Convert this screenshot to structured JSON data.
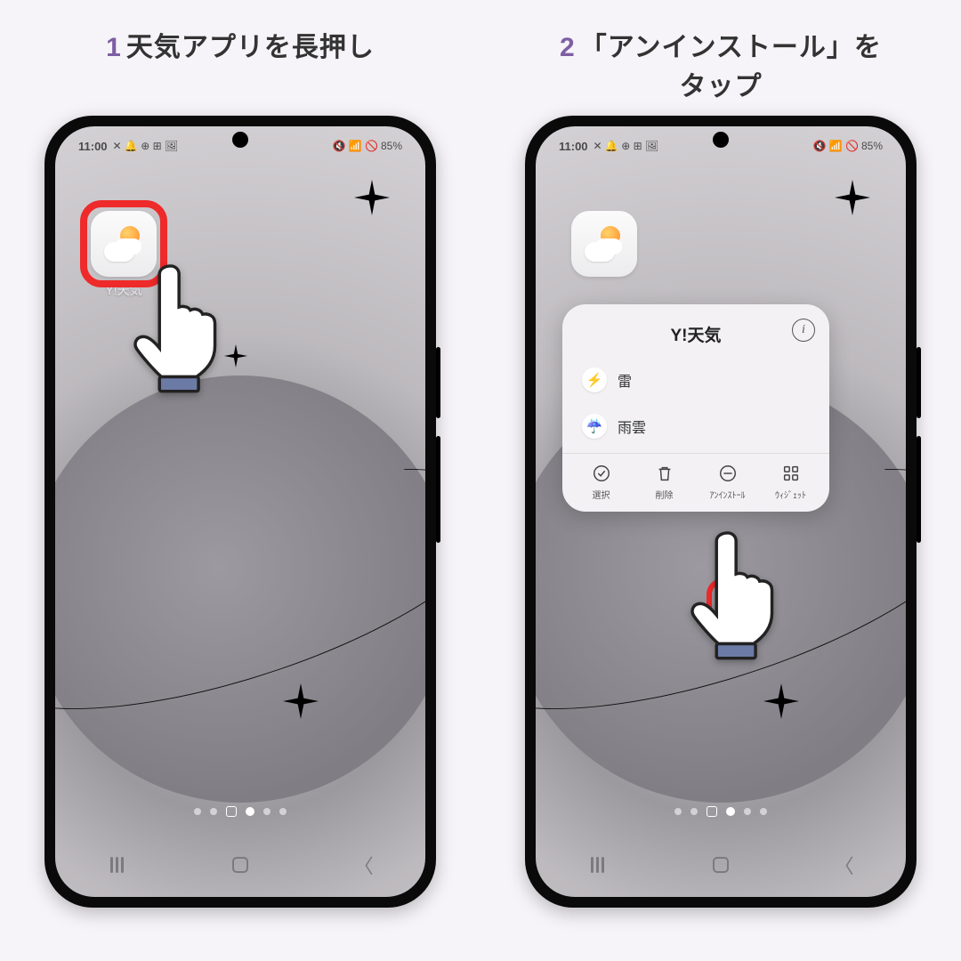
{
  "steps": [
    {
      "num": "1",
      "title": "天気アプリを長押し",
      "title2": ""
    },
    {
      "num": "2",
      "title": "「アンインストール」を",
      "title2": "タップ"
    }
  ],
  "status": {
    "time": "11:00",
    "left_icons": "✕ 🔔 ⊕ ⊞ 🖼",
    "right_icons": "🔇 📶 🚫",
    "battery": "85%"
  },
  "app": {
    "label": "Y!天気"
  },
  "popup": {
    "title": "Y!天気",
    "info_symbol": "i",
    "items": [
      {
        "icon": "⚡",
        "label": "雷"
      },
      {
        "icon": "☔",
        "label": "雨雲"
      }
    ],
    "actions": [
      {
        "key": "select",
        "label": "選択"
      },
      {
        "key": "remove",
        "label": "削除"
      },
      {
        "key": "uninstall",
        "label": "ｱﾝｲﾝｽﾄｰﾙ"
      },
      {
        "key": "widget",
        "label": "ｳｨｼﾞｪｯﾄ"
      }
    ]
  },
  "colors": {
    "highlight": "#ee2a2a",
    "step_num": "#7e5ea3"
  }
}
